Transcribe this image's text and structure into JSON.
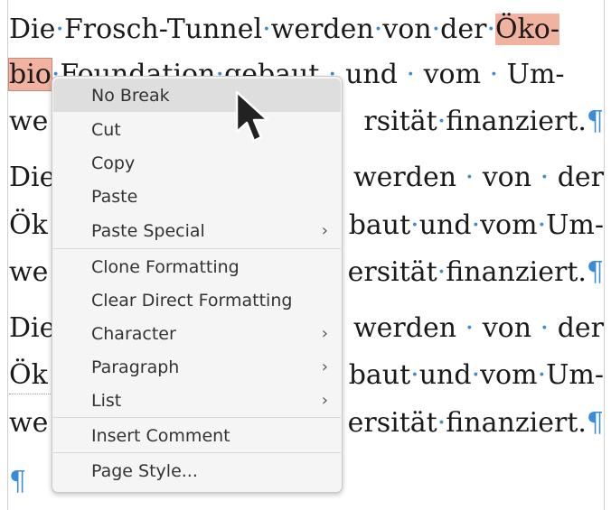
{
  "document": {
    "lines": [
      {
        "segments": [
          "Die",
          "Frosch-Tunnel",
          "werden",
          "von",
          "der",
          "Öko-"
        ]
      },
      {
        "segments": [
          "bio",
          "Foundation",
          "gebaut",
          "und",
          "vom",
          "Um-"
        ]
      },
      {
        "segments": [
          "we",
          "rsität",
          "finanziert."
        ]
      },
      {
        "segments": [
          "Die",
          "werden",
          "von",
          "der"
        ]
      },
      {
        "segments": [
          "Ök",
          "baut",
          "und",
          "vom",
          "Um-"
        ]
      },
      {
        "segments": [
          "we",
          "ersität",
          "finanziert."
        ]
      },
      {
        "segments": [
          "Die",
          "werden",
          "von",
          "der"
        ]
      },
      {
        "segments": [
          "Ök",
          "baut",
          "und",
          "vom",
          "Um-"
        ]
      },
      {
        "segments": [
          "we",
          "ersität",
          "finanziert."
        ]
      }
    ],
    "pilcrow": "¶",
    "space_dot": "·"
  },
  "context_menu": {
    "items": [
      {
        "label": "No Break",
        "mnemonic_index": 0,
        "submenu": false,
        "hovered": true
      },
      {
        "label": "Cut",
        "submenu": false
      },
      {
        "label": "Copy",
        "submenu": false
      },
      {
        "label": "Paste",
        "submenu": false
      },
      {
        "label": "Paste Special",
        "submenu": true
      },
      {
        "label": "Clone Formatting",
        "submenu": false
      },
      {
        "label": "Clear Direct Formatting",
        "submenu": false
      },
      {
        "label": "Character",
        "submenu": true
      },
      {
        "label": "Paragraph",
        "submenu": true
      },
      {
        "label": "List",
        "submenu": true
      },
      {
        "label": "Insert Comment",
        "submenu": false
      },
      {
        "label": "Page Style...",
        "submenu": false
      }
    ],
    "submenu_arrow": "›"
  },
  "colors": {
    "highlight": "#f2b2a0",
    "formatting_marks": "#3a8cd6"
  }
}
